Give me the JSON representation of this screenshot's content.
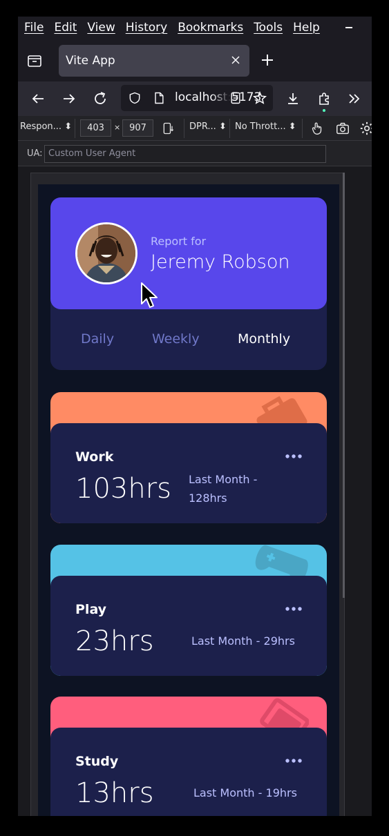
{
  "browser": {
    "menu": [
      "File",
      "Edit",
      "View",
      "History",
      "Bookmarks",
      "Tools",
      "Help"
    ],
    "tab_title": "Vite App",
    "url_text": "localhost:5173",
    "icons": [
      "tab-list-icon",
      "close-icon",
      "plus-icon",
      "back-icon",
      "forward-icon",
      "reload-icon",
      "shield-icon",
      "page-icon",
      "reader-icon",
      "star-icon",
      "download-icon",
      "extensions-icon",
      "overflow-icon"
    ]
  },
  "rdm": {
    "device": "Respon...",
    "width": "403",
    "times": "×",
    "height": "907",
    "dpr": "DPR...",
    "throttle": "No Thrott...",
    "ua_label": "UA:",
    "ua_placeholder": "Custom User Agent"
  },
  "profile": {
    "report_for": "Report for",
    "name": "Jeremy Robson",
    "periods": [
      "Daily",
      "Weekly",
      "Monthly"
    ],
    "active_period": "Monthly"
  },
  "activities": [
    {
      "title": "Work",
      "hours": "103hrs",
      "previous": "Last Month - 128hrs",
      "color": "#ff8b64",
      "icon": "briefcase-icon"
    },
    {
      "title": "Play",
      "hours": "23hrs",
      "previous": "Last Month - 29hrs",
      "color": "#55c2e6",
      "icon": "gamepad-icon"
    },
    {
      "title": "Study",
      "hours": "13hrs",
      "previous": "Last Month - 19hrs",
      "color": "#ff5e7d",
      "icon": "book-icon"
    }
  ],
  "colors": {
    "accent": "#5847eb",
    "card": "#1c204b",
    "page": "#0d1323"
  }
}
